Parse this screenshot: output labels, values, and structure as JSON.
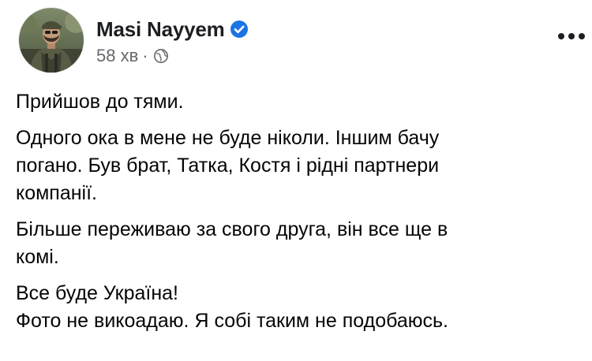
{
  "post": {
    "author": {
      "name": "Masi Nayyem",
      "verified": true
    },
    "timestamp": "58 хв",
    "meta_separator": "·",
    "audience_icon": "globe-icon",
    "more_icon": "more-options-icon",
    "body": {
      "paragraphs": [
        {
          "lines": [
            "Прийшов до тями."
          ]
        },
        {
          "lines": [
            "Одного ока в мене не буде ніколи. Іншим бачу",
            "погано. Був брат, Татка, Костя і рідні партнери",
            "компанії."
          ]
        },
        {
          "lines": [
            "Більше переживаю за свого друга, він все ще в",
            "комі."
          ]
        },
        {
          "lines": [
            "Все буде Україна!",
            "Фото не викоадаю. Я собі таким не подобаюсь."
          ]
        }
      ]
    }
  },
  "colors": {
    "verified_blue": "#1b74e4",
    "meta_gray": "#65676b",
    "text": "#050505"
  }
}
